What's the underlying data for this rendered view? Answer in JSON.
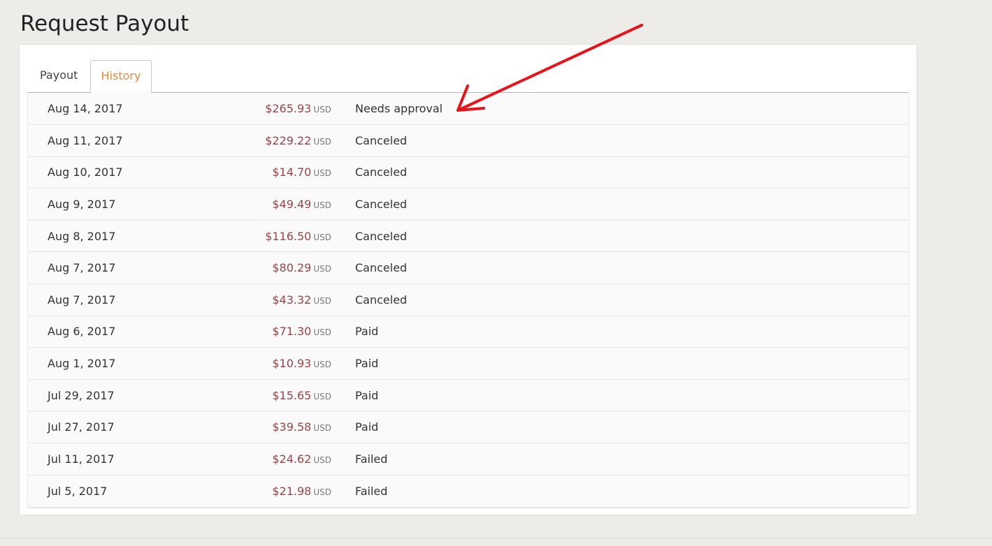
{
  "page": {
    "title": "Request Payout"
  },
  "tabs": [
    {
      "label": "Payout",
      "active": false
    },
    {
      "label": "History",
      "active": true
    }
  ],
  "history": {
    "rows": [
      {
        "date": "Aug 14, 2017",
        "amount": "$265.93",
        "currency": "USD",
        "status": "Needs approval"
      },
      {
        "date": "Aug 11, 2017",
        "amount": "$229.22",
        "currency": "USD",
        "status": "Canceled"
      },
      {
        "date": "Aug 10, 2017",
        "amount": "$14.70",
        "currency": "USD",
        "status": "Canceled"
      },
      {
        "date": "Aug 9, 2017",
        "amount": "$49.49",
        "currency": "USD",
        "status": "Canceled"
      },
      {
        "date": "Aug 8, 2017",
        "amount": "$116.50",
        "currency": "USD",
        "status": "Canceled"
      },
      {
        "date": "Aug 7, 2017",
        "amount": "$80.29",
        "currency": "USD",
        "status": "Canceled"
      },
      {
        "date": "Aug 7, 2017",
        "amount": "$43.32",
        "currency": "USD",
        "status": "Canceled"
      },
      {
        "date": "Aug 6, 2017",
        "amount": "$71.30",
        "currency": "USD",
        "status": "Paid"
      },
      {
        "date": "Aug 1, 2017",
        "amount": "$10.93",
        "currency": "USD",
        "status": "Paid"
      },
      {
        "date": "Jul 29, 2017",
        "amount": "$15.65",
        "currency": "USD",
        "status": "Paid"
      },
      {
        "date": "Jul 27, 2017",
        "amount": "$39.58",
        "currency": "USD",
        "status": "Paid"
      },
      {
        "date": "Jul 11, 2017",
        "amount": "$24.62",
        "currency": "USD",
        "status": "Failed"
      },
      {
        "date": "Jul 5, 2017",
        "amount": "$21.98",
        "currency": "USD",
        "status": "Failed"
      }
    ]
  },
  "colors": {
    "background": "#eeece8",
    "amount": "#99434a",
    "active_tab": "#e8893a",
    "annotation_arrow": "#e8141a"
  },
  "annotation": {
    "icon": "red-arrow-annotation-icon"
  }
}
